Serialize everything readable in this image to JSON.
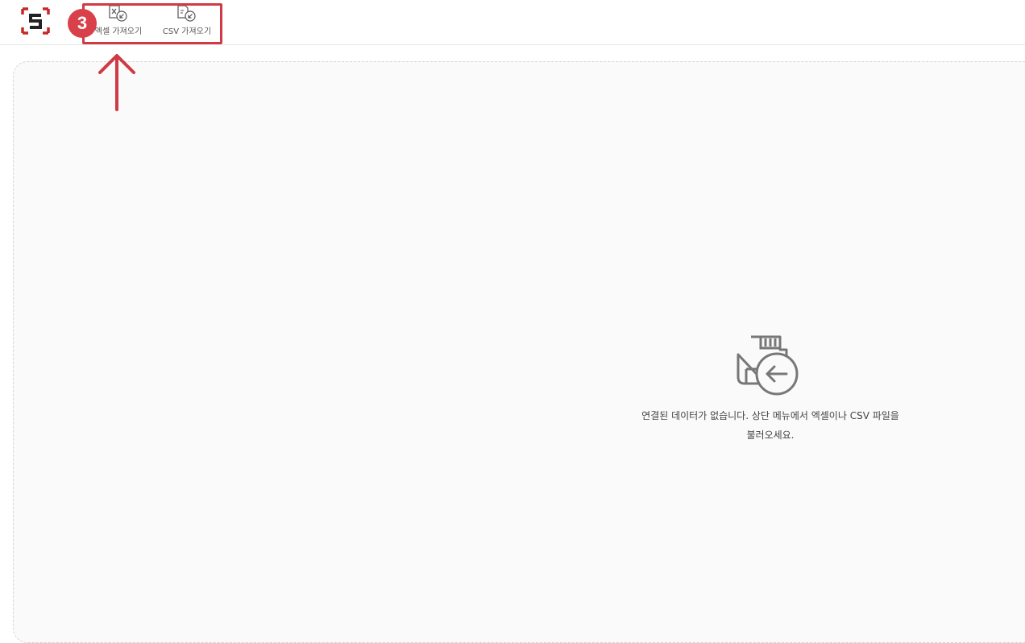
{
  "header": {
    "logo": {
      "icon": "s-bracket-logo",
      "colors": {
        "brackets": "#c62828",
        "letter": "#222222"
      }
    },
    "step_badge": "3",
    "toolbar": {
      "excel_import_label": "엑셀 가져오기",
      "excel_import_icon": "excel-import-icon",
      "csv_import_label": "CSV 가져오기",
      "csv_import_icon": "csv-import-icon"
    }
  },
  "annotation": {
    "highlight_color": "#cf3a44",
    "arrow_icon": "up-arrow-icon"
  },
  "main": {
    "empty_state": {
      "icon": "disk-import-icon",
      "message_line1": "연결된 데이터가 없습니다. 상단 메뉴에서 엑셀이나 CSV 파일을",
      "message_line2": "불러오세요."
    }
  },
  "colors": {
    "accent": "#d8404a",
    "panel_bg": "#fafafa",
    "panel_border": "#d6d6d6",
    "text_muted": "#555555"
  }
}
